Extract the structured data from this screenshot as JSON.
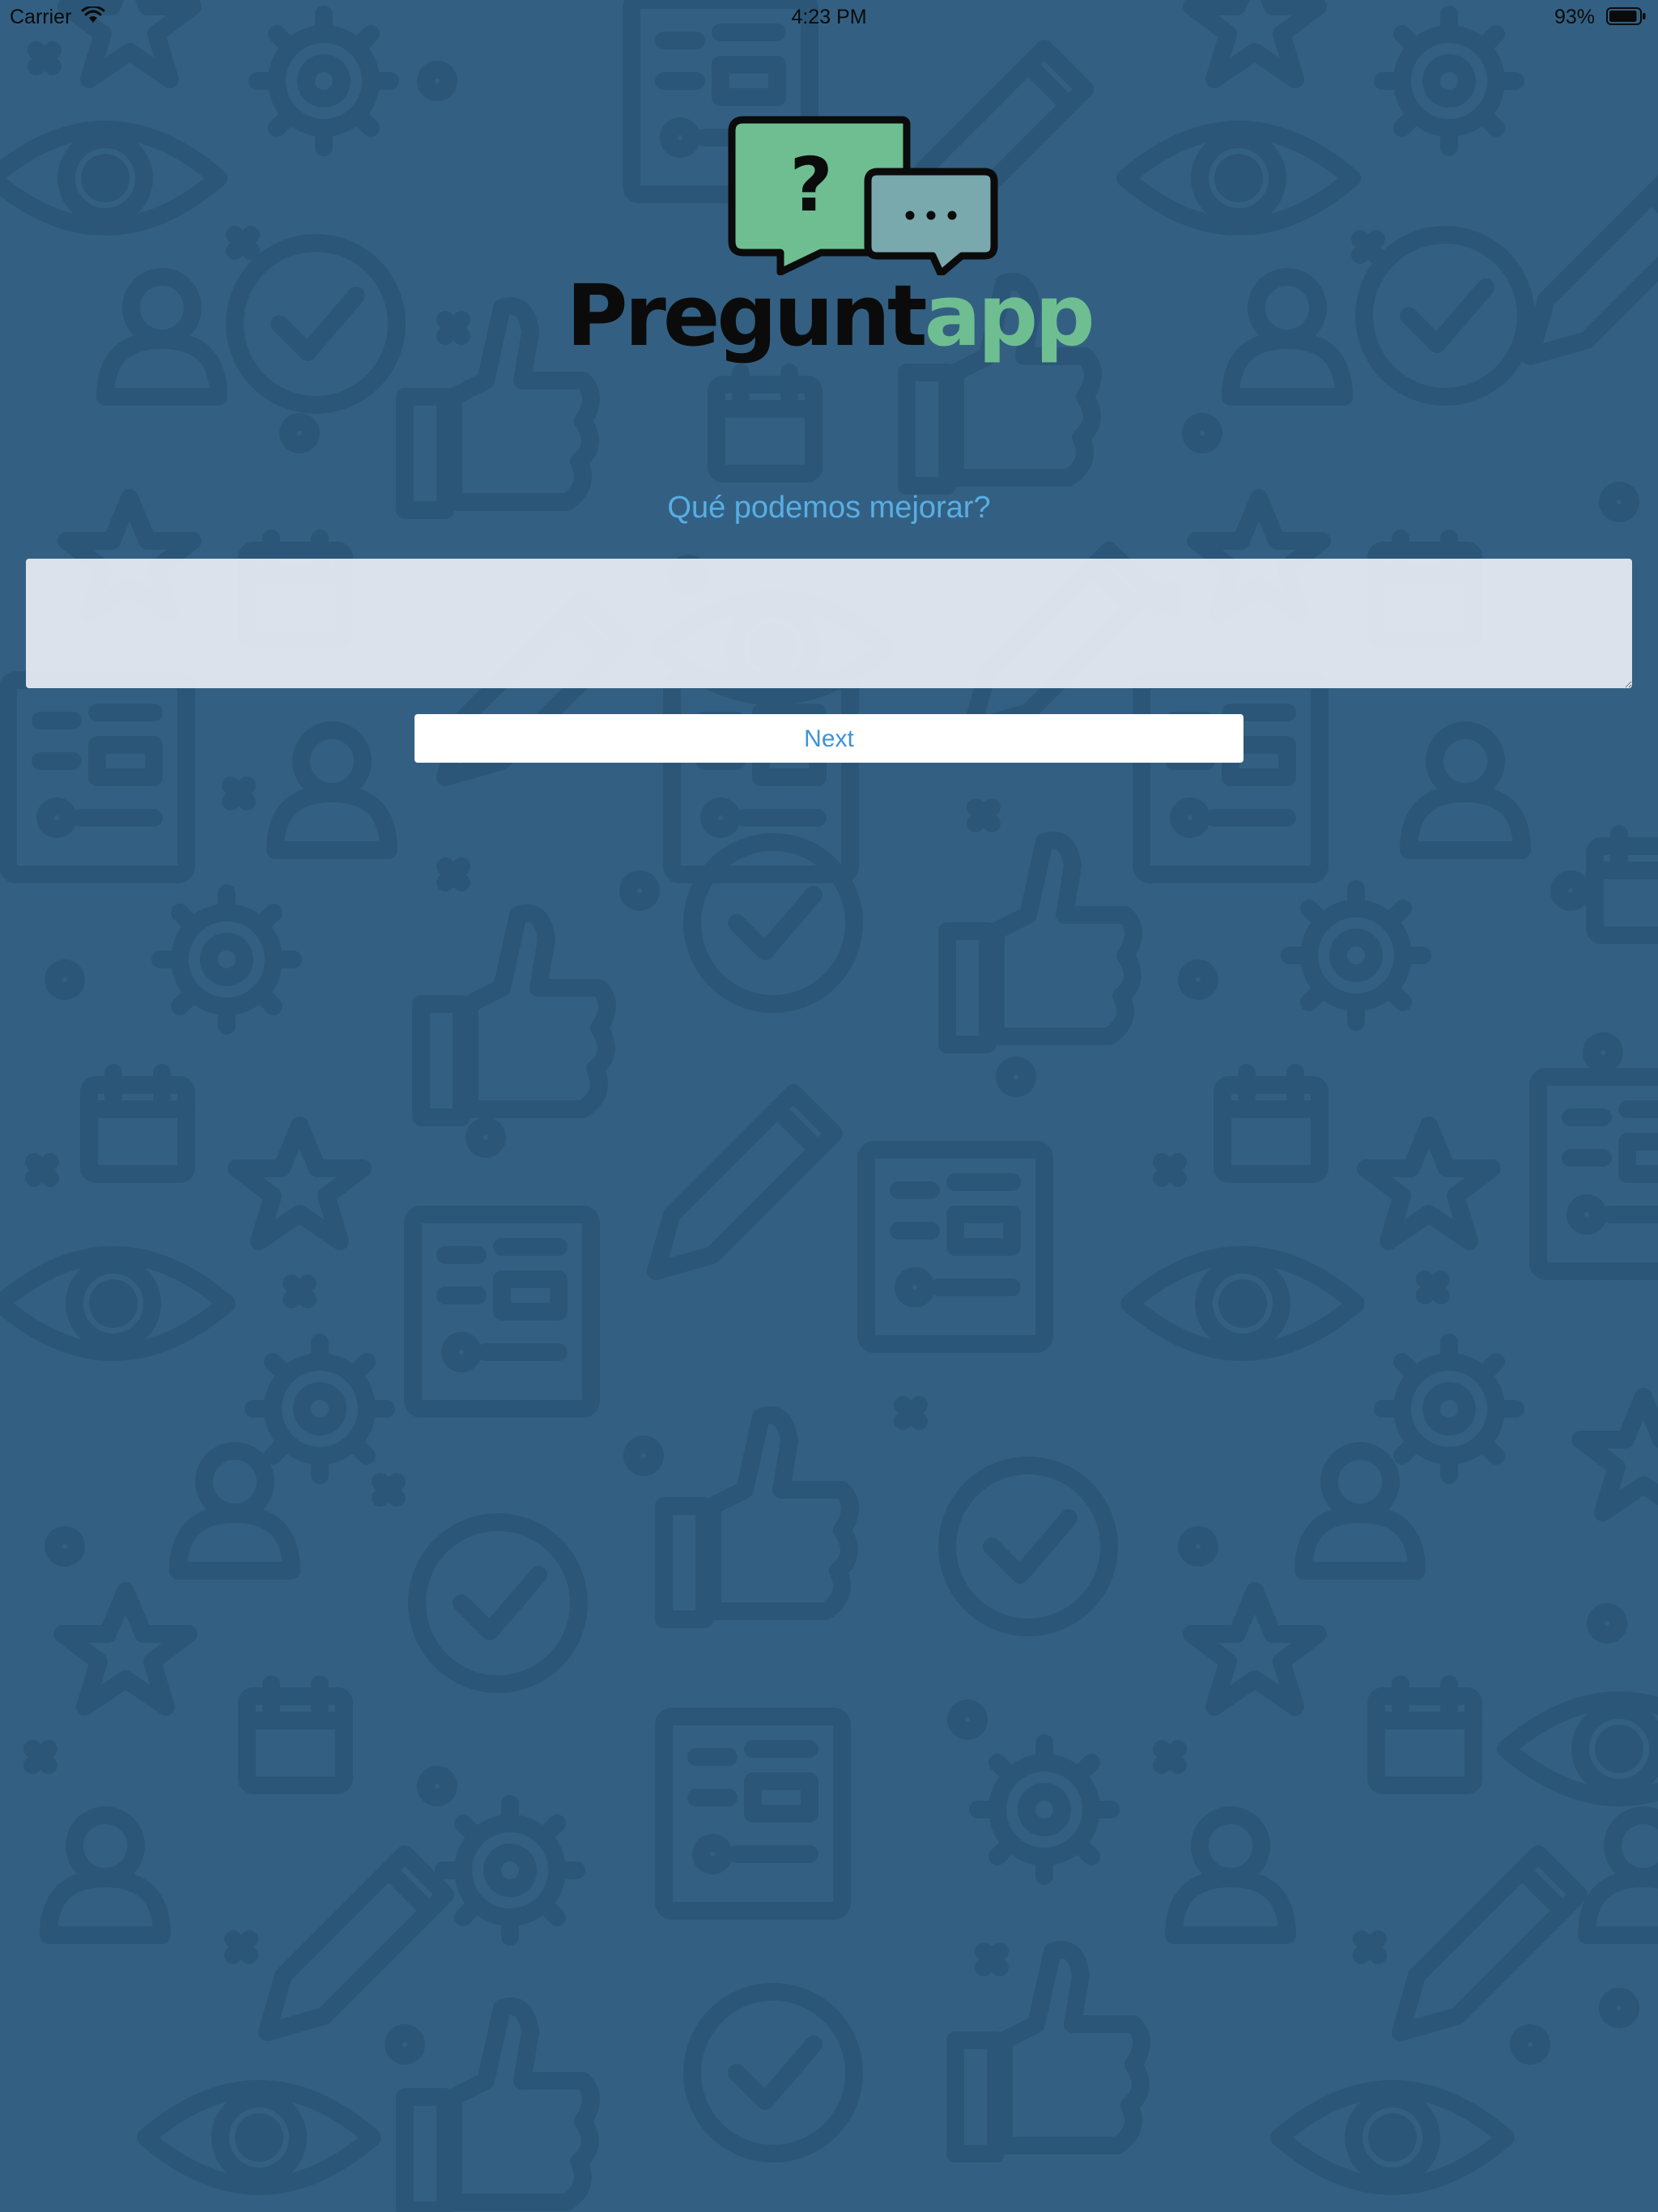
{
  "status_bar": {
    "carrier": "Carrier",
    "time": "4:23 PM",
    "battery_percent": "93%",
    "battery_level": 0.93,
    "wifi_icon": "wifi-icon",
    "battery_icon": "battery-icon"
  },
  "logo": {
    "word_dark": "Pregunt",
    "word_green": "app",
    "bubble_question_mark": "?",
    "bubble_dots": "...",
    "colors": {
      "dark": "#0b0b0b",
      "green": "#6fbe91",
      "teal": "#7aa9ad"
    }
  },
  "form": {
    "question": "Qué podemos mejorar?",
    "answer_value": "",
    "answer_placeholder": "",
    "next_label": "Next"
  },
  "theme": {
    "background": "#336082",
    "pattern": "#2b5677",
    "question_text": "#58aee6",
    "button_text": "#3d94d6"
  },
  "background_pattern_icons": [
    "eye-icon",
    "gear-icon",
    "pencil-icon",
    "user-icon",
    "check-circle-icon",
    "thumbs-up-icon",
    "calendar-icon",
    "star-icon",
    "document-icon"
  ]
}
